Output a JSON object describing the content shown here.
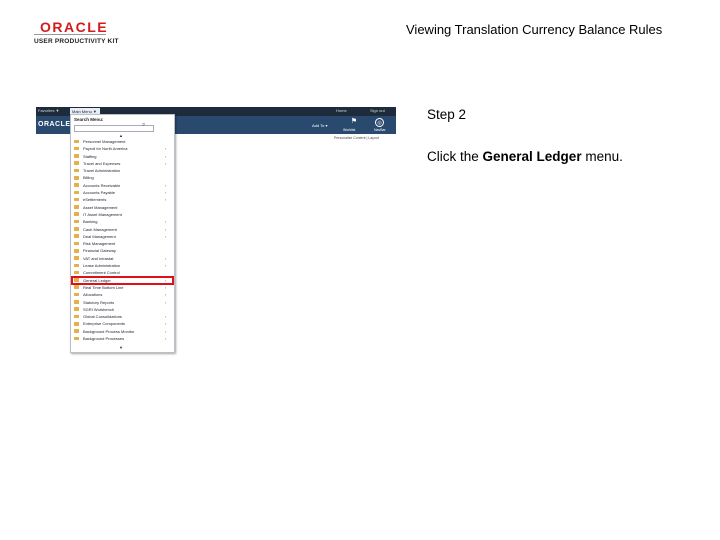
{
  "logo": {
    "brand": "ORACLE",
    "product": "USER PRODUCTIVITY KIT"
  },
  "doc_title": "Viewing Translation Currency Balance Rules",
  "step": {
    "label": "Step 2",
    "instruction_pre": "Click the ",
    "instruction_bold": "General Ledger",
    "instruction_post": " menu."
  },
  "screenshot": {
    "topbar": {
      "favorites": "Favorites ▼",
      "main_menu": "Main Menu ▼",
      "home": "Home",
      "sign_out": "Sign out"
    },
    "banner": {
      "brand": "ORACLE",
      "add_to": "Add To ▾",
      "worklist": "Worklist",
      "navbar": "NavBar"
    },
    "personalize": "Personalize Content | Layout",
    "menu": {
      "title": "Search Menu:",
      "items": [
        {
          "label": "Personnel Management",
          "sub": false
        },
        {
          "label": "Payroll for North America",
          "sub": true
        },
        {
          "label": "Staffing",
          "sub": true
        },
        {
          "label": "Travel and Expenses",
          "sub": true
        },
        {
          "label": "Travel Administration",
          "sub": false
        },
        {
          "label": "Billing",
          "sub": false
        },
        {
          "label": "Accounts Receivable",
          "sub": true
        },
        {
          "label": "Accounts Payable",
          "sub": true
        },
        {
          "label": "eSettlements",
          "sub": true
        },
        {
          "label": "Asset Management",
          "sub": false
        },
        {
          "label": "IT Asset Management",
          "sub": false
        },
        {
          "label": "Banking",
          "sub": true
        },
        {
          "label": "Cash Management",
          "sub": true
        },
        {
          "label": "Deal Management",
          "sub": true
        },
        {
          "label": "Risk Management",
          "sub": false
        },
        {
          "label": "Financial Gateway",
          "sub": false
        },
        {
          "label": "VAT and Intrastat",
          "sub": true
        },
        {
          "label": "Lease Administration",
          "sub": true
        },
        {
          "label": "Commitment Control",
          "sub": false
        },
        {
          "label": "General Ledger",
          "sub": true
        },
        {
          "label": "Real Time Bottom Line",
          "sub": true
        },
        {
          "label": "Allocations",
          "sub": true
        },
        {
          "label": "Statutory Reports",
          "sub": true
        },
        {
          "label": "SGRI Workbench",
          "sub": false
        },
        {
          "label": "Global Consolidations",
          "sub": true
        },
        {
          "label": "Enterprise Components",
          "sub": true
        },
        {
          "label": "Background Process Monitor",
          "sub": true
        },
        {
          "label": "Background Processes",
          "sub": true
        }
      ]
    }
  }
}
